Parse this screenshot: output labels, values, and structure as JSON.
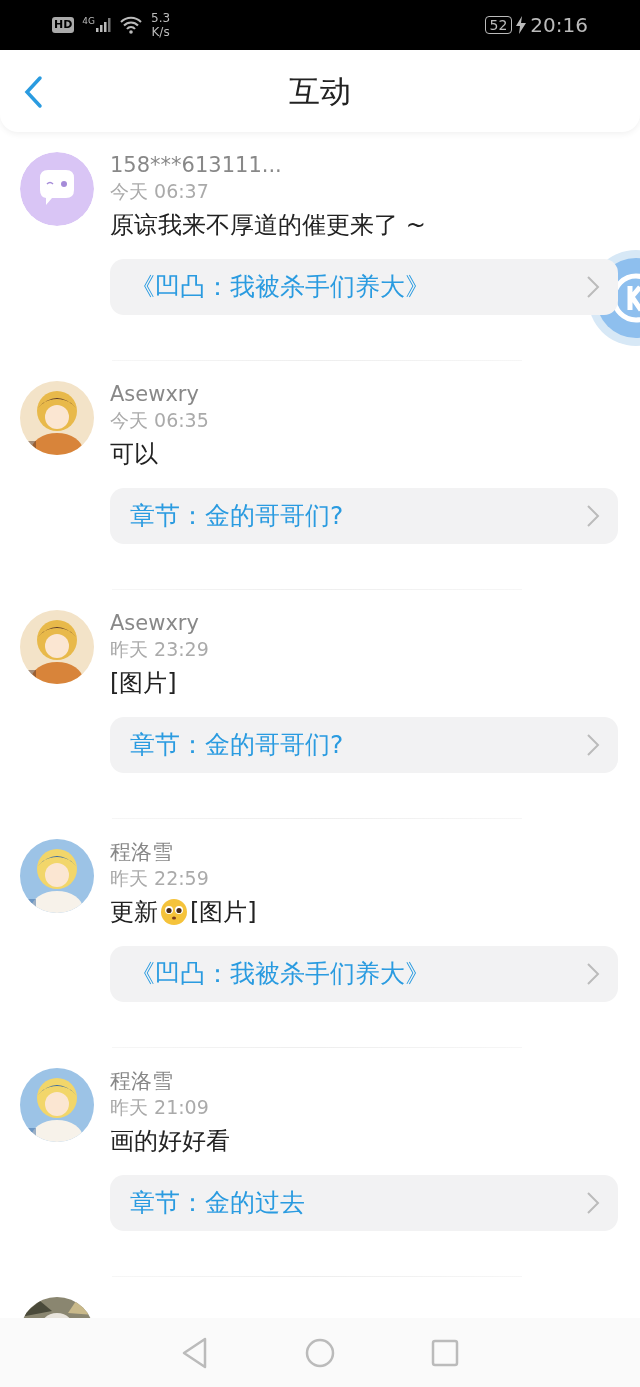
{
  "status_bar": {
    "hd": "HD",
    "network": "4G",
    "speed": "5.3",
    "speed_unit": "K/s",
    "battery": "52",
    "time": "20:16"
  },
  "header": {
    "title": "互动"
  },
  "items": [
    {
      "user": "158***613111...",
      "avatar": {
        "kind": "default"
      },
      "time": "今天 06:37",
      "message": [
        {
          "kind": "text",
          "text": "原谅我来不厚道的催更来了 ~"
        }
      ],
      "link": "《凹凸：我被杀手们养大》"
    },
    {
      "user": "Asewxry",
      "time": "今天 06:35",
      "message": [
        {
          "kind": "text",
          "text": "可以"
        }
      ],
      "link": "章节：金的哥哥们?"
    },
    {
      "user": "Asewxry",
      "time": "昨天 23:29",
      "message": [
        {
          "kind": "text",
          "text": "[图片]"
        }
      ],
      "link": "章节：金的哥哥们?"
    },
    {
      "user": "程洛雪",
      "time": "昨天 22:59",
      "message": [
        {
          "kind": "text",
          "text": "更新"
        },
        {
          "kind": "emoji"
        },
        {
          "kind": "text",
          "text": "[图片]"
        }
      ],
      "link": "《凹凸：我被杀手们养大》"
    },
    {
      "user": "程洛雪",
      "time": "昨天 21:09",
      "message": [
        {
          "kind": "text",
          "text": "画的好好看"
        }
      ],
      "link": "章节：金的过去"
    }
  ]
}
